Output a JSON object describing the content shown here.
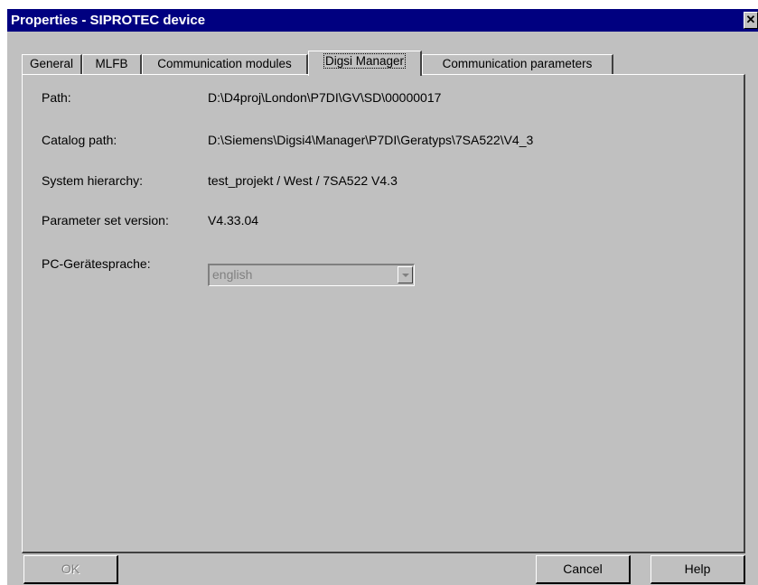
{
  "window": {
    "title": "Properties - SIPROTEC device",
    "close_glyph": "✕"
  },
  "tabs": [
    {
      "label": "General",
      "active": false
    },
    {
      "label": "MLFB",
      "active": false
    },
    {
      "label": "Communication modules",
      "active": false
    },
    {
      "label": "Digsi Manager",
      "active": true
    },
    {
      "label": "Communication parameters",
      "active": false
    }
  ],
  "fields": {
    "path": {
      "label": "Path:",
      "value": "D:\\D4proj\\London\\P7DI\\GV\\SD\\00000017"
    },
    "catalog_path": {
      "label": "Catalog path:",
      "value": "D:\\Siemens\\Digsi4\\Manager\\P7DI\\Geratyps\\7SA522\\V4_3"
    },
    "system_hierarchy": {
      "label": "System hierarchy:",
      "value": "test_projekt / West / 7SA522 V4.3"
    },
    "parameter_set_version": {
      "label": "Parameter set version:",
      "value": "V4.33.04"
    },
    "pc_language": {
      "label": "PC-Gerätesprache:",
      "value": "english",
      "disabled": true
    }
  },
  "buttons": {
    "ok": {
      "label": "OK",
      "disabled": true
    },
    "cancel": {
      "label": "Cancel"
    },
    "help": {
      "label": "Help"
    }
  },
  "colors": {
    "titlebar": "#000080",
    "face": "#c0c0c0",
    "disabled_text": "#808080"
  }
}
